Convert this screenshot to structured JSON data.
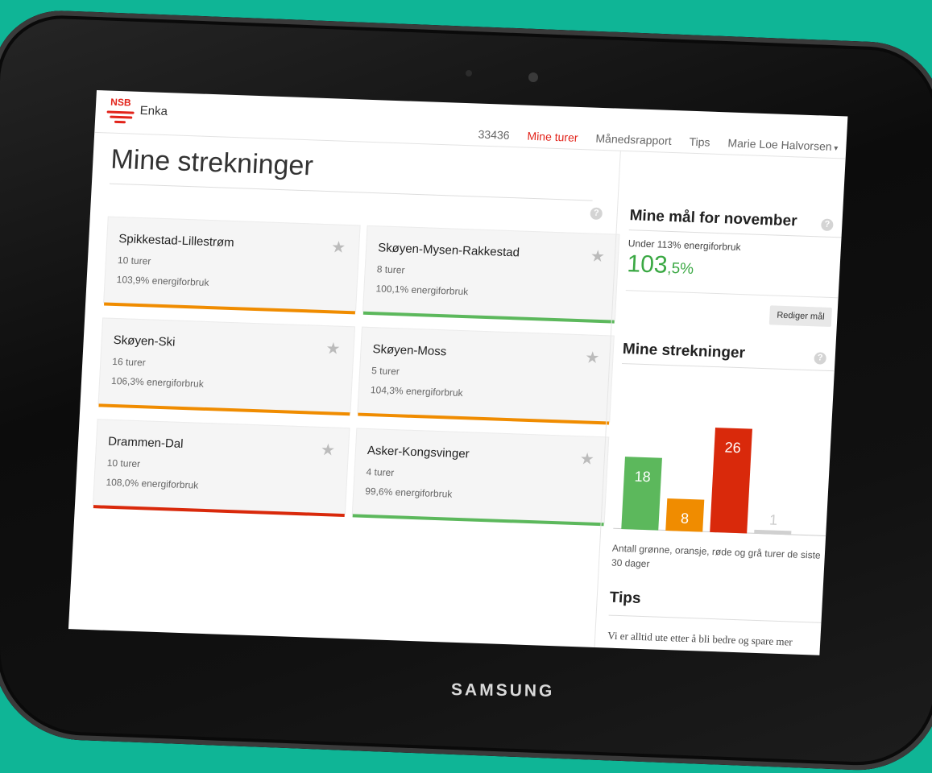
{
  "device": {
    "brand": "SAMSUNG"
  },
  "header": {
    "logo_text": "NSB",
    "app_name": "Enka",
    "nav": [
      "33436",
      "Mine turer",
      "Månedsrapport",
      "Tips",
      "Marie Loe Halvorsen"
    ]
  },
  "colors": {
    "green": "#5cb85c",
    "orange": "#f08c00",
    "red": "#d9290b",
    "grey": "#d0d0d0",
    "accent": "#e2231a"
  },
  "main": {
    "title": "Mine strekninger",
    "help": "?",
    "routes": [
      {
        "name": "Spikkestad-Lillestrøm",
        "trips": "10 turer",
        "energy": "103,9% energiforbruk",
        "status": "orange"
      },
      {
        "name": "Skøyen-Mysen-Rakkestad",
        "trips": "8 turer",
        "energy": "100,1% energiforbruk",
        "status": "green"
      },
      {
        "name": "Skøyen-Ski",
        "trips": "16 turer",
        "energy": "106,3% energiforbruk",
        "status": "orange"
      },
      {
        "name": "Skøyen-Moss",
        "trips": "5 turer",
        "energy": "104,3% energiforbruk",
        "status": "orange"
      },
      {
        "name": "Drammen-Dal",
        "trips": "10 turer",
        "energy": "108,0% energiforbruk",
        "status": "red"
      },
      {
        "name": "Asker-Kongsvinger",
        "trips": "4 turer",
        "energy": "99,6% energiforbruk",
        "status": "green"
      }
    ]
  },
  "sidebar": {
    "goal_title": "Mine mål for november",
    "goal_text": "Under 113% energiforbruk",
    "goal_value_main": "103",
    "goal_value_decimal": ",5%",
    "edit_button": "Rediger mål",
    "routes_title": "Mine strekninger",
    "chart_caption": "Antall grønne, oransje, røde og grå turer de siste 30 dager",
    "tips_title": "Tips",
    "tips_text": "Vi er alltid ute etter å bli bedre og spare mer"
  },
  "chart_data": {
    "type": "bar",
    "categories": [
      "grønne",
      "oransje",
      "røde",
      "grå"
    ],
    "values": [
      18,
      8,
      26,
      1
    ],
    "colors": [
      "#5cb85c",
      "#f08c00",
      "#d9290b",
      "#d0d0d0"
    ],
    "ylim": [
      0,
      30
    ]
  }
}
